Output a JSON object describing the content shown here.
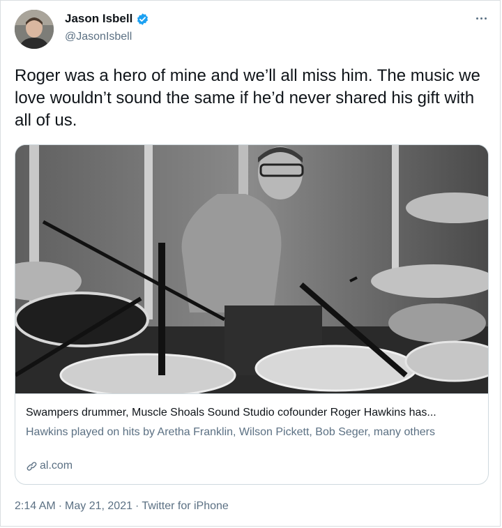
{
  "user": {
    "name": "Jason Isbell",
    "handle": "@JasonIsbell",
    "verified": true
  },
  "tweet": {
    "text": "Roger was a hero of mine and we’ll all miss him. The music we love wouldn’t sound the same if he’d never shared his gift with all of us."
  },
  "card": {
    "title": "Swampers drummer, Muscle Shoals Sound Studio cofounder Roger Hawkins has...",
    "description": "Hawkins played on hits by Aretha Franklin, Wilson Pickett, Bob Seger, many others",
    "domain": "al.com"
  },
  "meta": {
    "time": "2:14 AM",
    "date": "May 21, 2021",
    "separator": "·",
    "source": "Twitter for iPhone"
  },
  "colors": {
    "verified": "#1da1f2",
    "secondary_text": "#5b7083",
    "border": "#cfd9de"
  }
}
